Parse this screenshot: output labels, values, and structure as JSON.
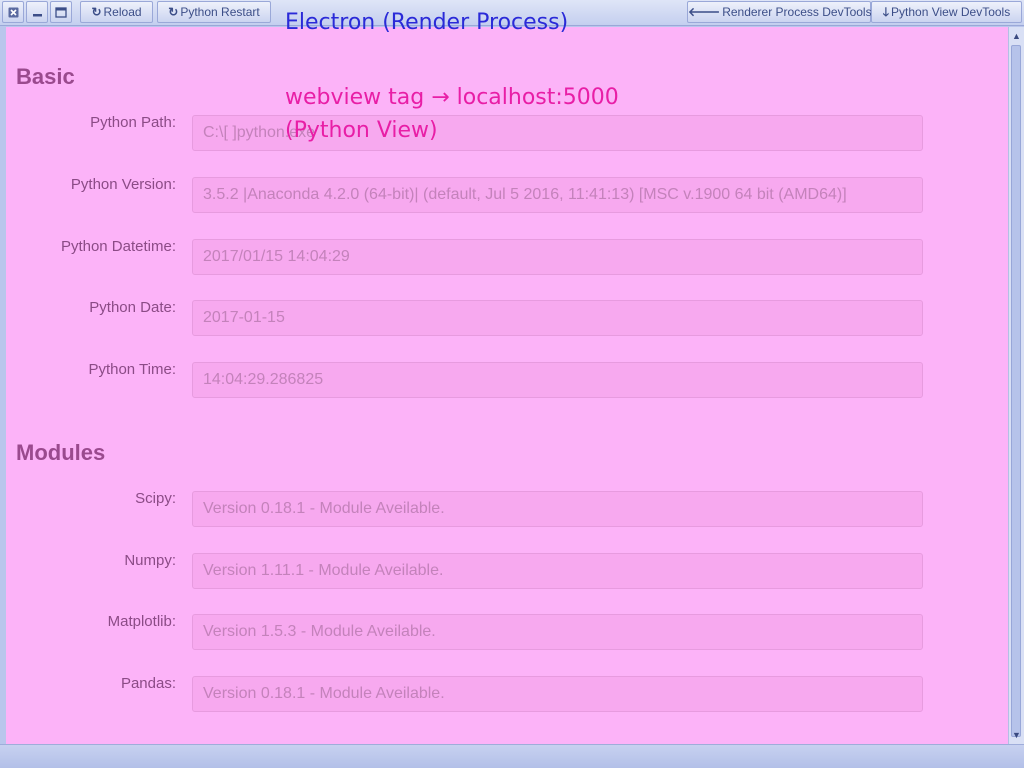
{
  "toolbar": {
    "reload_label": "Reload",
    "python_restart_label": "Python Restart",
    "renderer_devtools_label": "Renderer Process DevTools",
    "python_devtools_label": "Python View DevTools",
    "icons": [
      "close-icon",
      "minimize-icon",
      "maximize-icon",
      "reload-icon",
      "restart-icon",
      "arrow-left-icon",
      "arrow-down-icon"
    ]
  },
  "annotations": {
    "electron": "Electron (Render Process)",
    "webview_line1": "webview tag → localhost:5000",
    "webview_line2": "(Python View)"
  },
  "basic": {
    "title": "Basic",
    "rows": [
      {
        "label": "Python Path:",
        "value": "C:\\[               ]python.exe"
      },
      {
        "label": "Python Version:",
        "value": "3.5.2 |Anaconda 4.2.0 (64-bit)| (default, Jul  5 2016, 11:41:13) [MSC v.1900 64 bit (AMD64)]"
      },
      {
        "label": "Python Datetime:",
        "value": "2017/01/15 14:04:29"
      },
      {
        "label": "Python Date:",
        "value": "2017-01-15"
      },
      {
        "label": "Python Time:",
        "value": "14:04:29.286825"
      }
    ]
  },
  "modules": {
    "title": "Modules",
    "rows": [
      {
        "label": "Scipy:",
        "value": "Version 0.18.1 - Module Aveilable."
      },
      {
        "label": "Numpy:",
        "value": "Version 1.11.1 - Module Aveilable."
      },
      {
        "label": "Matplotlib:",
        "value": "Version 1.5.3 - Module Aveilable."
      },
      {
        "label": "Pandas:",
        "value": "Version 0.18.1 - Module Aveilable."
      }
    ]
  },
  "colors": {
    "webview_bg": "#fcb3f8",
    "electron_note": "#2a2ad8",
    "webview_note": "#e81ea6"
  }
}
